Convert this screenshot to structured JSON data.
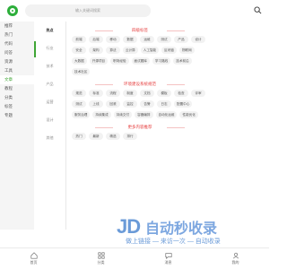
{
  "header": {
    "search_placeholder": "输入关键词搜索"
  },
  "sidebar": {
    "items": [
      {
        "label": "推荐",
        "active": false
      },
      {
        "label": "热门",
        "active": false
      },
      {
        "label": "代码",
        "active": false
      },
      {
        "label": "问答",
        "active": false
      },
      {
        "label": "资源",
        "active": false
      },
      {
        "label": "工具",
        "active": false
      },
      {
        "label": "文章",
        "active": true
      },
      {
        "label": "教程",
        "active": false
      },
      {
        "label": "分类",
        "active": false
      },
      {
        "label": "标签",
        "active": false
      },
      {
        "label": "专题",
        "active": false
      }
    ]
  },
  "tabs": [
    {
      "label": "热点",
      "active": true
    },
    {
      "label": "行业",
      "active": false
    },
    {
      "label": "技术",
      "active": false
    },
    {
      "label": "产品",
      "active": false
    },
    {
      "label": "运营",
      "active": false
    },
    {
      "label": "设计",
      "active": false
    },
    {
      "label": "其他",
      "active": false
    }
  ],
  "sections": [
    {
      "title": "四级标签",
      "chips": [
        "前端",
        "后端",
        "移动",
        "数据",
        "运维",
        "测试",
        "产品",
        "设计",
        "安全",
        "架构",
        "算法",
        "云计算",
        "人工智能",
        "区块链",
        "物联网",
        "大数据",
        "开源项目",
        "职场经验",
        "面试题库",
        "学习路线",
        "技术前沿",
        "技术社区"
      ]
    },
    {
      "title": "环境建设系统规范",
      "chips": [
        "规范",
        "标准",
        "流程",
        "制度",
        "文档",
        "模板",
        "检查",
        "评审",
        "测试",
        "上线",
        "回滚",
        "监控",
        "告警",
        "日志",
        "配置中心",
        "服务治理",
        "持续集成",
        "持续交付",
        "容器编排",
        "自动化运维",
        "性能优化"
      ]
    },
    {
      "title": "更多内容推荐",
      "chips": [
        "热门",
        "最新",
        "精选",
        "排行"
      ]
    }
  ],
  "watermark": {
    "logo_text": "JD",
    "title": "自动秒收录",
    "subtitle": "做上链接 — 来访一次 — 自动收录"
  },
  "bottom_nav": [
    {
      "label": "首页",
      "icon": "home-icon"
    },
    {
      "label": "分类",
      "icon": "grid-icon"
    },
    {
      "label": "消息",
      "icon": "chat-icon"
    },
    {
      "label": "我的",
      "icon": "user-icon"
    }
  ],
  "colors": {
    "accent": "#3fa535",
    "section_title": "#e53e3e",
    "watermark": "#6b9bd8"
  }
}
